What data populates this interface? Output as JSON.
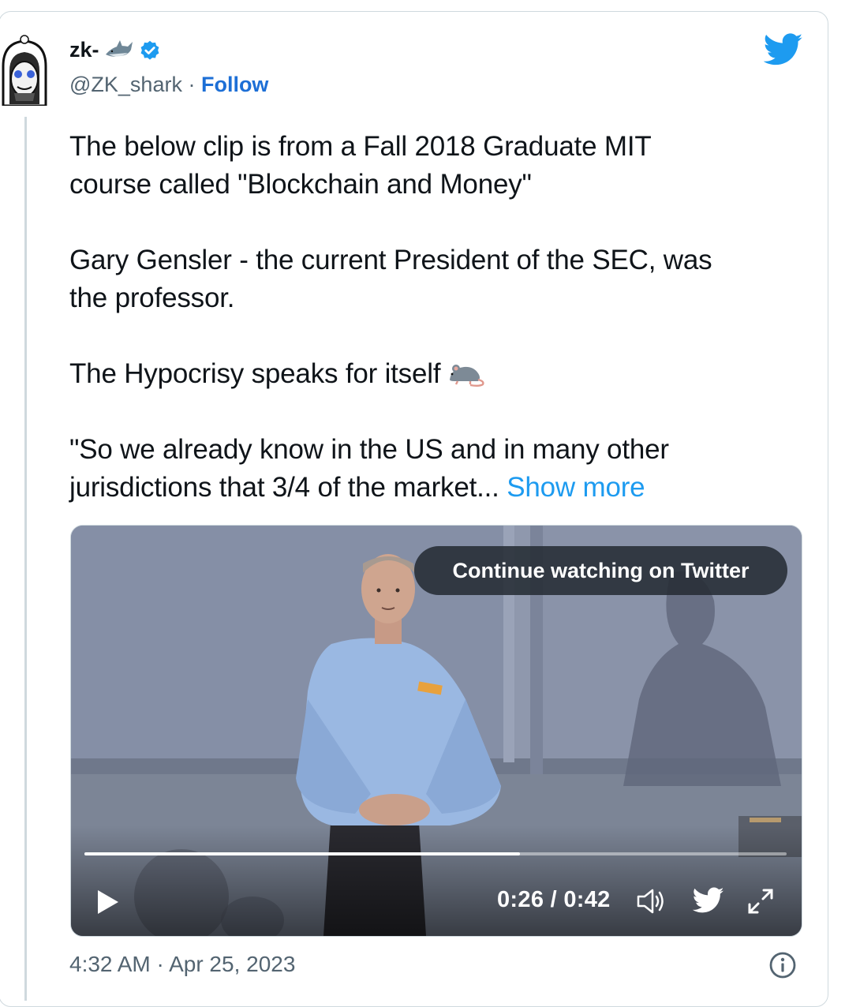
{
  "user": {
    "display_name": "zk-",
    "handle_line": "@ZK_shark · ",
    "follow_label": "Follow"
  },
  "tweet": {
    "paragraph_1_line_1": "The below clip is from a Fall 2018 Graduate MIT",
    "paragraph_1_line_2": "course called \"Blockchain and Money\"",
    "paragraph_2_line_1": "Gary Gensler - the current President of the SEC, was",
    "paragraph_2_line_2": "the professor.",
    "paragraph_3": "The Hypocrisy speaks for itself",
    "paragraph_4_line_1": "\"So we already know in the US and in many other",
    "paragraph_4_line_2": "jurisdictions that 3/4 of the market...",
    "show_more": "Show more"
  },
  "video": {
    "continue_label": "Continue watching on Twitter",
    "time_display": "0:26 / 0:42",
    "progress_fraction": 0.62
  },
  "footer": {
    "timestamp": "4:32 AM · Apr 25, 2023"
  },
  "colors": {
    "accent": "#1d9bf0",
    "follow": "#1d6fd6",
    "secondary_text": "#536471",
    "border": "#cfd9de"
  },
  "icons": [
    "avatar-image",
    "shark-emoji-icon",
    "verified-badge-icon",
    "twitter-bird-icon",
    "rat-emoji-icon",
    "play-icon",
    "volume-icon",
    "video-twitter-icon",
    "fullscreen-icon",
    "info-icon"
  ]
}
